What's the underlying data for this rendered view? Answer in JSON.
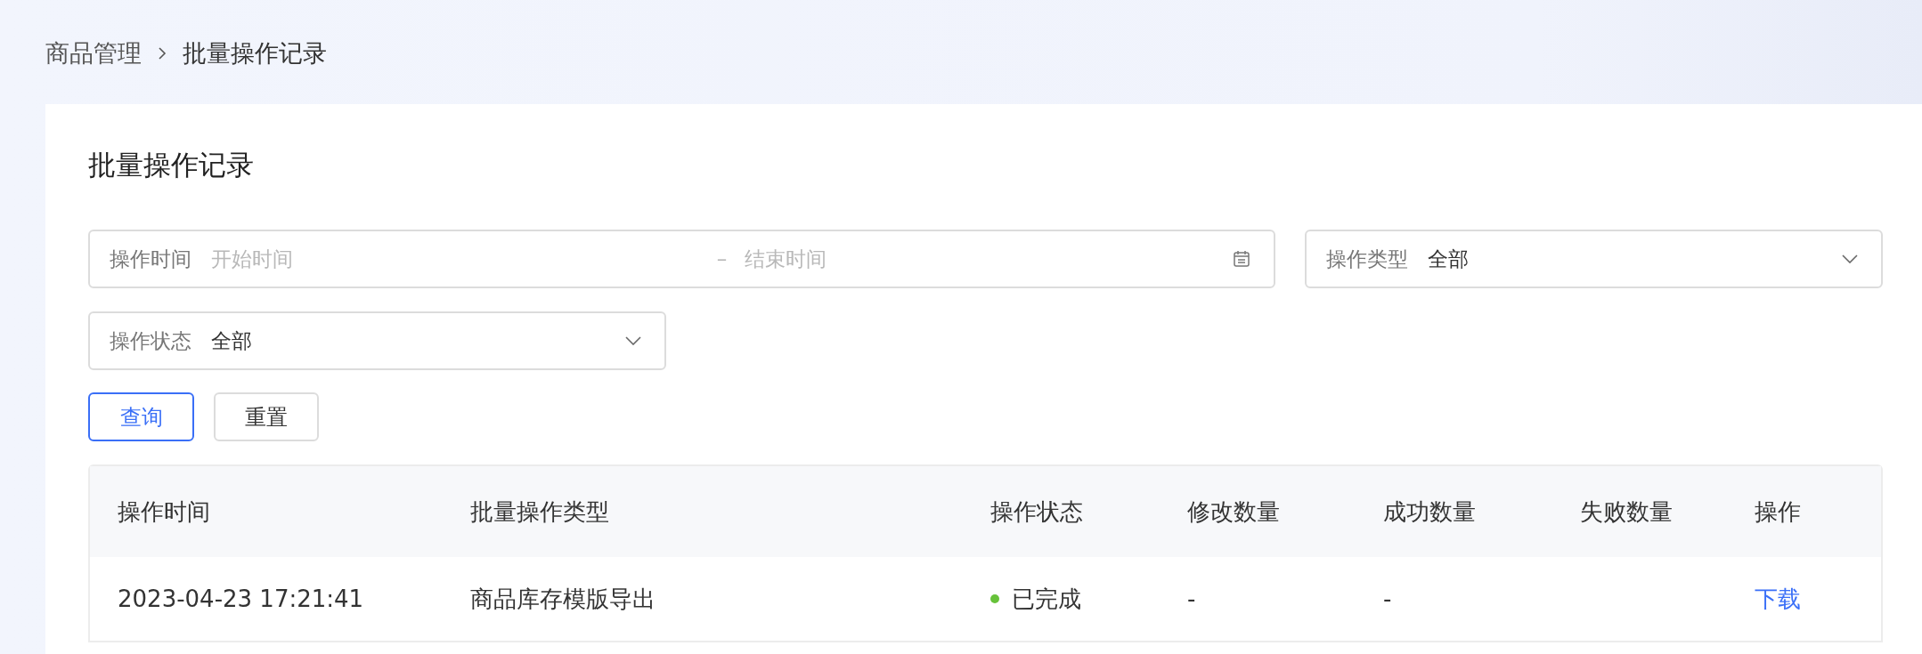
{
  "breadcrumb": [
    "商品管理",
    "批量操作记录"
  ],
  "page_title": "批量操作记录",
  "filters": {
    "time": {
      "label": "操作时间",
      "start_placeholder": "开始时间",
      "separator": "–",
      "end_placeholder": "结束时间"
    },
    "type": {
      "label": "操作类型",
      "value": "全部"
    },
    "status": {
      "label": "操作状态",
      "value": "全部"
    }
  },
  "buttons": [
    {
      "label": "查询",
      "kind": "primary"
    },
    {
      "label": "重置",
      "kind": "default"
    }
  ],
  "table": {
    "columns": [
      "操作时间",
      "批量操作类型",
      "操作状态",
      "修改数量",
      "成功数量",
      "失败数量",
      "操作"
    ],
    "rows": [
      {
        "time": "2023-04-23 17:21:41",
        "type": "商品库存模版导出",
        "status": "已完成",
        "color": "#67c23a",
        "modified": "-",
        "success": "-",
        "action": "下载"
      }
    ]
  }
}
